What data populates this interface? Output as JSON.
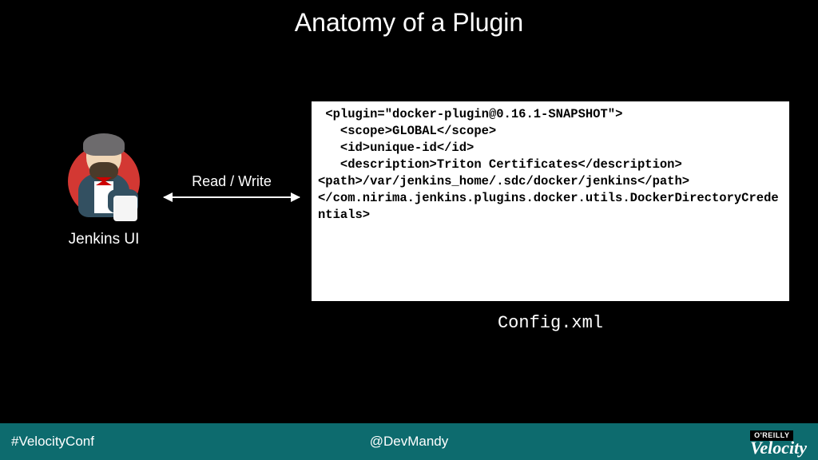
{
  "title": "Anatomy of a Plugin",
  "jenkins": {
    "label": "Jenkins UI"
  },
  "arrow": {
    "label": "Read / Write"
  },
  "code": {
    "content": " <plugin=\"docker-plugin@0.16.1-SNAPSHOT\">\n   <scope>GLOBAL</scope>\n   <id>unique-id</id>\n   <description>Triton Certificates</description>\n<path>/var/jenkins_home/.sdc/docker/jenkins</path>\n</com.nirima.jenkins.plugins.docker.utils.DockerDirectoryCredentials>",
    "caption": "Config.xml"
  },
  "footer": {
    "hashtag": "#VelocityConf",
    "handle": "@DevMandy",
    "publisher": "O'REILLY",
    "conference": "Velocity"
  }
}
